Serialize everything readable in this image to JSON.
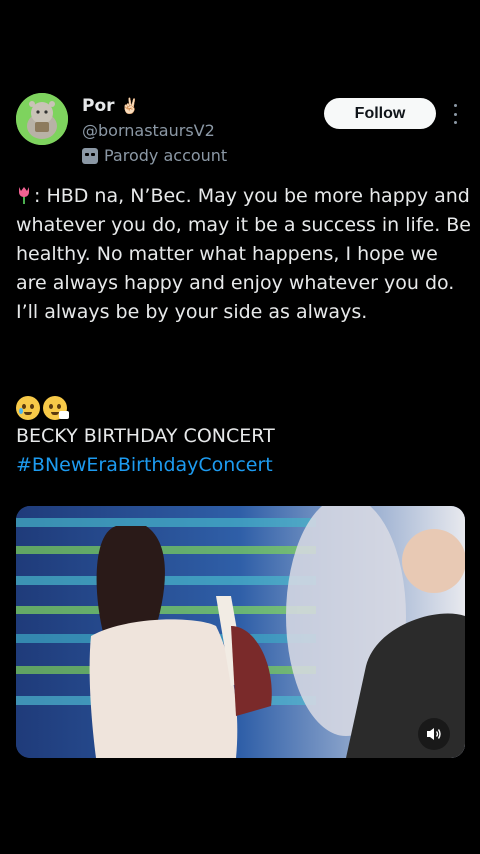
{
  "post": {
    "author": {
      "display_name": "Por",
      "name_emoji": "✌🏻",
      "handle": "@bornastaursV2",
      "account_label": "Parody account",
      "account_label_icon": "mask-icon"
    },
    "follow_label": "Follow",
    "more_icon": "more-vertical-icon",
    "text_icon": "tulip-icon",
    "text": ": HBD na, N’Bec. May you be more happy and whatever you do, may it be a success in life. Be healthy. No matter what happens, I hope we are always happy and enjoy whatever you do. I’ll always be by your side as always.",
    "emojis": [
      "crying-face-emoji",
      "sneezing-face-emoji"
    ],
    "concert_title": "BECKY BIRTHDAY CONCERT",
    "hashtag": "#BNewEraBirthdayConcert",
    "media": {
      "type": "video",
      "sound_icon": "volume-icon"
    }
  },
  "colors": {
    "background": "#000000",
    "text": "#e7e9ea",
    "muted": "#8b98a5",
    "link": "#1d9bf0",
    "button_bg": "#f7f9f9",
    "avatar_bg": "#7ed35e"
  }
}
